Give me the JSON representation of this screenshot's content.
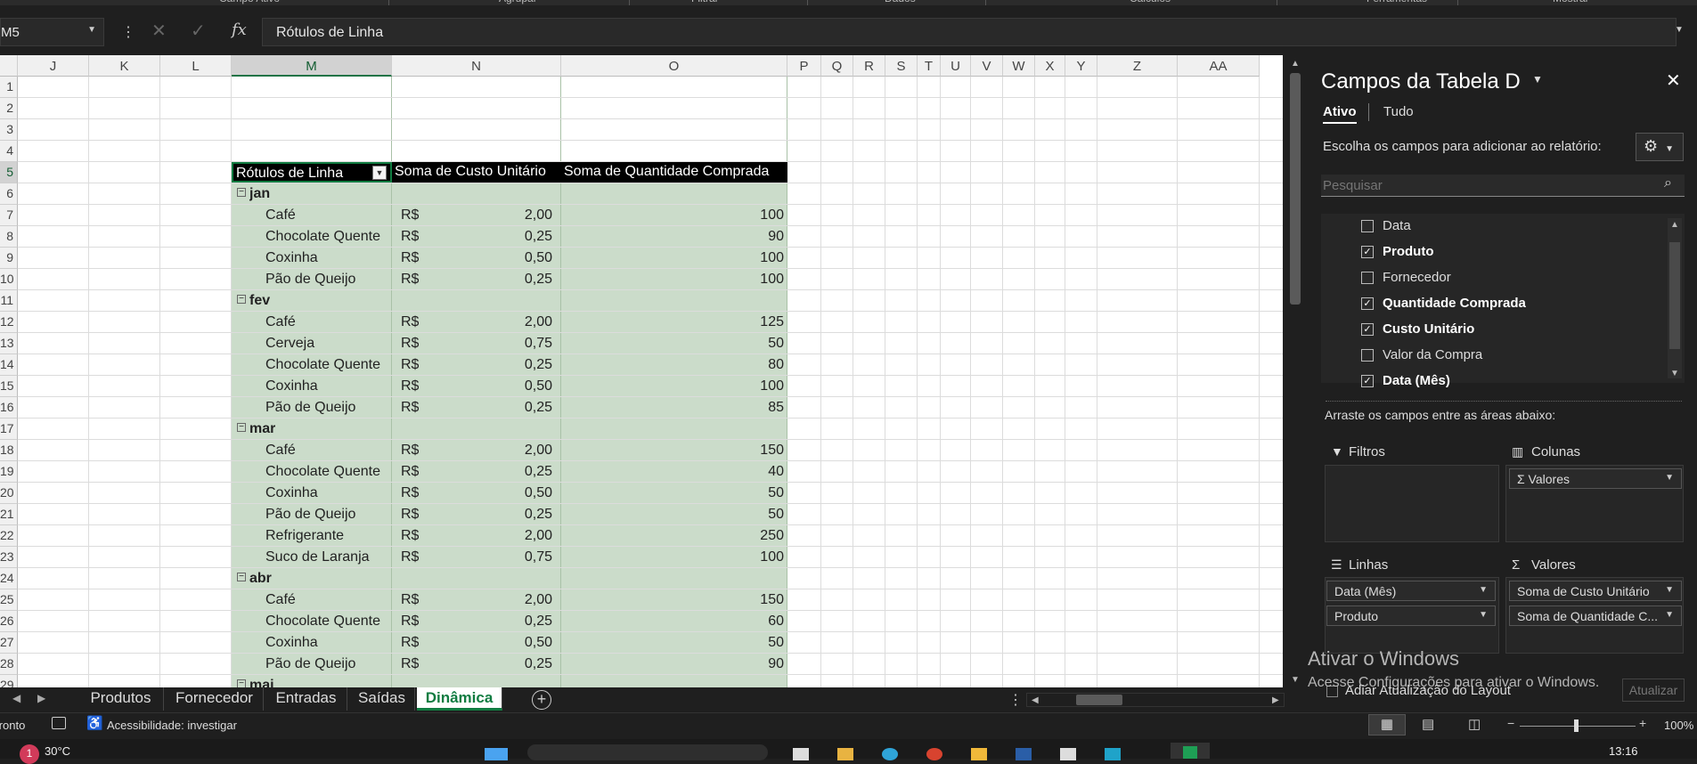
{
  "ribbon": {
    "groups": [
      "Campo Ativo",
      "Agrupar",
      "Filtrar",
      "Dados",
      "Cálculos",
      "Ferramentas",
      "Mostrar"
    ]
  },
  "formula_bar": {
    "name_box": "M5",
    "fx": "fx",
    "value": "Rótulos de Linha"
  },
  "columns": [
    "J",
    "K",
    "L",
    "M",
    "N",
    "O",
    "P",
    "Q",
    "R",
    "S",
    "T",
    "U",
    "V",
    "W",
    "X",
    "Y",
    "Z",
    "AA"
  ],
  "rows": [
    "1",
    "2",
    "3",
    "4",
    "5",
    "6",
    "7",
    "8",
    "9",
    "10",
    "11",
    "12",
    "13",
    "14",
    "15",
    "16",
    "17",
    "18",
    "19",
    "20",
    "21",
    "22",
    "23",
    "24",
    "25",
    "26",
    "27",
    "28",
    "29"
  ],
  "pivot": {
    "headers": [
      "Rótulos de Linha",
      "Soma de Custo Unitário",
      "Soma de Quantidade Comprada"
    ],
    "rows": [
      {
        "label": "jan",
        "group": true
      },
      {
        "label": "Café",
        "currency": "R$",
        "cost": "2,00",
        "qty": "100"
      },
      {
        "label": "Chocolate Quente",
        "currency": "R$",
        "cost": "0,25",
        "qty": "90"
      },
      {
        "label": "Coxinha",
        "currency": "R$",
        "cost": "0,50",
        "qty": "100"
      },
      {
        "label": "Pão de Queijo",
        "currency": "R$",
        "cost": "0,25",
        "qty": "100"
      },
      {
        "label": "fev",
        "group": true
      },
      {
        "label": "Café",
        "currency": "R$",
        "cost": "2,00",
        "qty": "125"
      },
      {
        "label": "Cerveja",
        "currency": "R$",
        "cost": "0,75",
        "qty": "50"
      },
      {
        "label": "Chocolate Quente",
        "currency": "R$",
        "cost": "0,25",
        "qty": "80"
      },
      {
        "label": "Coxinha",
        "currency": "R$",
        "cost": "0,50",
        "qty": "100"
      },
      {
        "label": "Pão de Queijo",
        "currency": "R$",
        "cost": "0,25",
        "qty": "85"
      },
      {
        "label": "mar",
        "group": true
      },
      {
        "label": "Café",
        "currency": "R$",
        "cost": "2,00",
        "qty": "150"
      },
      {
        "label": "Chocolate Quente",
        "currency": "R$",
        "cost": "0,25",
        "qty": "40"
      },
      {
        "label": "Coxinha",
        "currency": "R$",
        "cost": "0,50",
        "qty": "50"
      },
      {
        "label": "Pão de Queijo",
        "currency": "R$",
        "cost": "0,25",
        "qty": "50"
      },
      {
        "label": "Refrigerante",
        "currency": "R$",
        "cost": "2,00",
        "qty": "250"
      },
      {
        "label": "Suco de Laranja",
        "currency": "R$",
        "cost": "0,75",
        "qty": "100"
      },
      {
        "label": "abr",
        "group": true
      },
      {
        "label": "Café",
        "currency": "R$",
        "cost": "2,00",
        "qty": "150"
      },
      {
        "label": "Chocolate Quente",
        "currency": "R$",
        "cost": "0,25",
        "qty": "60"
      },
      {
        "label": "Coxinha",
        "currency": "R$",
        "cost": "0,50",
        "qty": "50"
      },
      {
        "label": "Pão de Queijo",
        "currency": "R$",
        "cost": "0,25",
        "qty": "90"
      },
      {
        "label": "mai",
        "group": true
      }
    ]
  },
  "sheets": [
    "Produtos",
    "Fornecedor",
    "Entradas",
    "Saídas",
    "Dinâmica"
  ],
  "active_sheet": "Dinâmica",
  "status": {
    "ready": "Pronto",
    "accessibility": "Acessibilidade: investigar",
    "zoom": "100%",
    "minus": "−",
    "plus": "+"
  },
  "panel": {
    "title": "Campos da Tabela Dinâmica",
    "tab_active": "Ativo",
    "tab_all": "Tudo",
    "instruction": "Escolha os campos para adicionar ao relatório:",
    "search_placeholder": "Pesquisar",
    "fields": [
      {
        "name": "Data",
        "checked": false
      },
      {
        "name": "Produto",
        "checked": true
      },
      {
        "name": "Fornecedor",
        "checked": false
      },
      {
        "name": "Quantidade Comprada",
        "checked": true
      },
      {
        "name": "Custo Unitário",
        "checked": true
      },
      {
        "name": "Valor da Compra",
        "checked": false
      },
      {
        "name": "Data (Mês)",
        "checked": true
      }
    ],
    "drag_hint": "Arraste os campos entre as áreas abaixo:",
    "areas": {
      "filters": {
        "label": "Filtros",
        "items": []
      },
      "columns": {
        "label": "Colunas",
        "items": [
          "Σ Valores"
        ]
      },
      "rows": {
        "label": "Linhas",
        "items": [
          "Data (Mês)",
          "Produto"
        ]
      },
      "values": {
        "label": "Valores",
        "items": [
          "Soma de Custo Unitário",
          "Soma de Quantidade C..."
        ]
      }
    },
    "defer_label": "Adiar Atualização do Layout",
    "update_button": "Atualizar"
  },
  "watermark": {
    "line1": "Ativar o Windows",
    "line2": "Acesse Configurações para ativar o Windows."
  },
  "taskbar": {
    "weather": "30°C",
    "clock": "13:16",
    "badge": "1"
  },
  "colors": {
    "accent": "#107c41",
    "pivot_fill": "#cbdcca",
    "pivot_header": "#000000"
  }
}
